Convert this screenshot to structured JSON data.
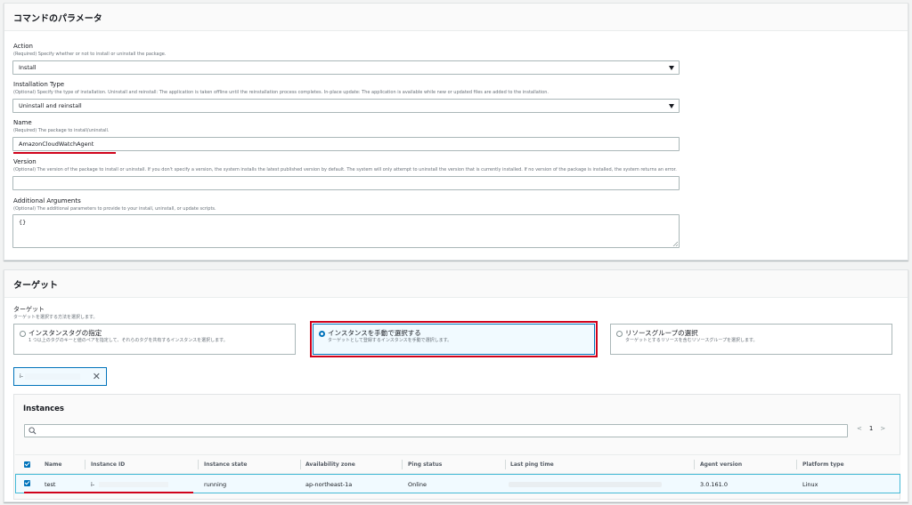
{
  "params": {
    "title": "コマンドのパラメータ",
    "action": {
      "label": "Action",
      "desc": "(Required) Specify whether or not to install or uninstall the package.",
      "value": "Install"
    },
    "install_type": {
      "label": "Installation Type",
      "desc": "(Optional) Specify the type of installation. Uninstall and reinstall: The application is taken offline until the reinstallation process completes. In-place update: The application is available while new or updated files are added to the installation.",
      "value": "Uninstall and reinstall"
    },
    "name": {
      "label": "Name",
      "desc": "(Required) The package to install/uninstall.",
      "value": "AmazonCloudWatchAgent"
    },
    "version": {
      "label": "Version",
      "desc": "(Optional) The version of the package to install or uninstall. If you don't specify a version, the system installs the latest published version by default. The system will only attempt to uninstall the version that is currently installed. If no version of the package is installed, the system returns an error.",
      "value": ""
    },
    "args": {
      "label": "Additional Arguments",
      "desc": "(Optional) The additional parameters to provide to your install, uninstall, or update scripts.",
      "value": "{}"
    }
  },
  "target": {
    "title": "ターゲット",
    "label": "ターゲット",
    "desc": "ターゲットを選択する方法を選択します。",
    "options": [
      {
        "title": "インスタンスタグの指定",
        "desc": "1 つ以上のタグのキーと値のペアを指定して、それらのタグを共有するインスタンスを選択します。"
      },
      {
        "title": "インスタンスを手動で選択する",
        "desc": "ターゲットとして登録するインスタンスを手動で選択します。"
      },
      {
        "title": "リソースグループの選択",
        "desc": "ターゲットとするリソースを含むリソースグループを選択します。"
      }
    ],
    "token_prefix": "i-"
  },
  "instances": {
    "title": "Instances",
    "page": "1",
    "columns": [
      "Name",
      "Instance ID",
      "Instance state",
      "Availability zone",
      "Ping status",
      "Last ping time",
      "Agent version",
      "Platform type"
    ],
    "rows": [
      {
        "name": "test",
        "id": "i-",
        "state": "running",
        "az": "ap-northeast-1a",
        "ping": "Online",
        "last_ping": "",
        "agent": "3.0.161.0",
        "platform": "Linux"
      }
    ]
  },
  "colors": {
    "accent": "#0073bb",
    "highlight": "#d0021b",
    "selected_bg": "#f1faff"
  }
}
